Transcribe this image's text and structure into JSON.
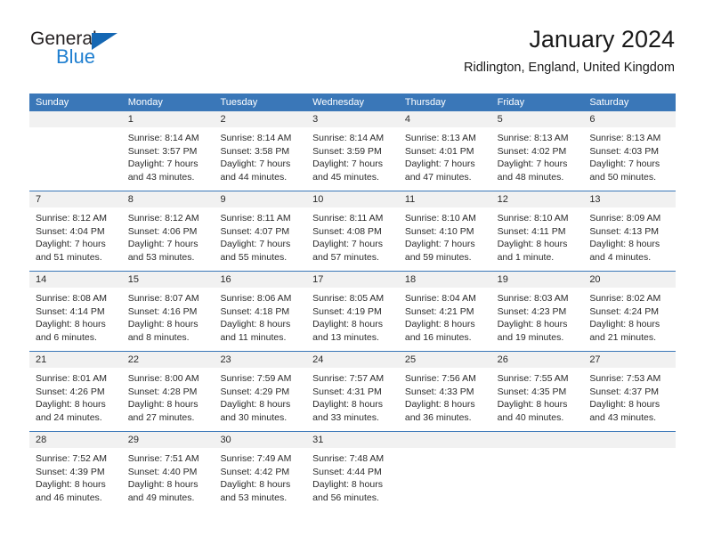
{
  "brand": {
    "name_top": "General",
    "name_bottom": "Blue",
    "triangle_icon": "triangle-icon",
    "color_primary": "#1567b3",
    "color_secondary": "#1f7fd0"
  },
  "header": {
    "title": "January 2024",
    "subtitle": "Ridlington, England, United Kingdom"
  },
  "calendar": {
    "header_bg": "#3a77b8",
    "daynum_bg": "#f1f1f1",
    "weekday_names": [
      "Sunday",
      "Monday",
      "Tuesday",
      "Wednesday",
      "Thursday",
      "Friday",
      "Saturday"
    ],
    "weeks": [
      {
        "numbers": [
          "",
          "1",
          "2",
          "3",
          "4",
          "5",
          "6"
        ],
        "days": [
          {
            "lines": [
              "",
              "",
              "",
              ""
            ]
          },
          {
            "lines": [
              "Sunrise: 8:14 AM",
              "Sunset: 3:57 PM",
              "Daylight: 7 hours",
              "and 43 minutes."
            ]
          },
          {
            "lines": [
              "Sunrise: 8:14 AM",
              "Sunset: 3:58 PM",
              "Daylight: 7 hours",
              "and 44 minutes."
            ]
          },
          {
            "lines": [
              "Sunrise: 8:14 AM",
              "Sunset: 3:59 PM",
              "Daylight: 7 hours",
              "and 45 minutes."
            ]
          },
          {
            "lines": [
              "Sunrise: 8:13 AM",
              "Sunset: 4:01 PM",
              "Daylight: 7 hours",
              "and 47 minutes."
            ]
          },
          {
            "lines": [
              "Sunrise: 8:13 AM",
              "Sunset: 4:02 PM",
              "Daylight: 7 hours",
              "and 48 minutes."
            ]
          },
          {
            "lines": [
              "Sunrise: 8:13 AM",
              "Sunset: 4:03 PM",
              "Daylight: 7 hours",
              "and 50 minutes."
            ]
          }
        ]
      },
      {
        "numbers": [
          "7",
          "8",
          "9",
          "10",
          "11",
          "12",
          "13"
        ],
        "days": [
          {
            "lines": [
              "Sunrise: 8:12 AM",
              "Sunset: 4:04 PM",
              "Daylight: 7 hours",
              "and 51 minutes."
            ]
          },
          {
            "lines": [
              "Sunrise: 8:12 AM",
              "Sunset: 4:06 PM",
              "Daylight: 7 hours",
              "and 53 minutes."
            ]
          },
          {
            "lines": [
              "Sunrise: 8:11 AM",
              "Sunset: 4:07 PM",
              "Daylight: 7 hours",
              "and 55 minutes."
            ]
          },
          {
            "lines": [
              "Sunrise: 8:11 AM",
              "Sunset: 4:08 PM",
              "Daylight: 7 hours",
              "and 57 minutes."
            ]
          },
          {
            "lines": [
              "Sunrise: 8:10 AM",
              "Sunset: 4:10 PM",
              "Daylight: 7 hours",
              "and 59 minutes."
            ]
          },
          {
            "lines": [
              "Sunrise: 8:10 AM",
              "Sunset: 4:11 PM",
              "Daylight: 8 hours",
              "and 1 minute."
            ]
          },
          {
            "lines": [
              "Sunrise: 8:09 AM",
              "Sunset: 4:13 PM",
              "Daylight: 8 hours",
              "and 4 minutes."
            ]
          }
        ]
      },
      {
        "numbers": [
          "14",
          "15",
          "16",
          "17",
          "18",
          "19",
          "20"
        ],
        "days": [
          {
            "lines": [
              "Sunrise: 8:08 AM",
              "Sunset: 4:14 PM",
              "Daylight: 8 hours",
              "and 6 minutes."
            ]
          },
          {
            "lines": [
              "Sunrise: 8:07 AM",
              "Sunset: 4:16 PM",
              "Daylight: 8 hours",
              "and 8 minutes."
            ]
          },
          {
            "lines": [
              "Sunrise: 8:06 AM",
              "Sunset: 4:18 PM",
              "Daylight: 8 hours",
              "and 11 minutes."
            ]
          },
          {
            "lines": [
              "Sunrise: 8:05 AM",
              "Sunset: 4:19 PM",
              "Daylight: 8 hours",
              "and 13 minutes."
            ]
          },
          {
            "lines": [
              "Sunrise: 8:04 AM",
              "Sunset: 4:21 PM",
              "Daylight: 8 hours",
              "and 16 minutes."
            ]
          },
          {
            "lines": [
              "Sunrise: 8:03 AM",
              "Sunset: 4:23 PM",
              "Daylight: 8 hours",
              "and 19 minutes."
            ]
          },
          {
            "lines": [
              "Sunrise: 8:02 AM",
              "Sunset: 4:24 PM",
              "Daylight: 8 hours",
              "and 21 minutes."
            ]
          }
        ]
      },
      {
        "numbers": [
          "21",
          "22",
          "23",
          "24",
          "25",
          "26",
          "27"
        ],
        "days": [
          {
            "lines": [
              "Sunrise: 8:01 AM",
              "Sunset: 4:26 PM",
              "Daylight: 8 hours",
              "and 24 minutes."
            ]
          },
          {
            "lines": [
              "Sunrise: 8:00 AM",
              "Sunset: 4:28 PM",
              "Daylight: 8 hours",
              "and 27 minutes."
            ]
          },
          {
            "lines": [
              "Sunrise: 7:59 AM",
              "Sunset: 4:29 PM",
              "Daylight: 8 hours",
              "and 30 minutes."
            ]
          },
          {
            "lines": [
              "Sunrise: 7:57 AM",
              "Sunset: 4:31 PM",
              "Daylight: 8 hours",
              "and 33 minutes."
            ]
          },
          {
            "lines": [
              "Sunrise: 7:56 AM",
              "Sunset: 4:33 PM",
              "Daylight: 8 hours",
              "and 36 minutes."
            ]
          },
          {
            "lines": [
              "Sunrise: 7:55 AM",
              "Sunset: 4:35 PM",
              "Daylight: 8 hours",
              "and 40 minutes."
            ]
          },
          {
            "lines": [
              "Sunrise: 7:53 AM",
              "Sunset: 4:37 PM",
              "Daylight: 8 hours",
              "and 43 minutes."
            ]
          }
        ]
      },
      {
        "numbers": [
          "28",
          "29",
          "30",
          "31",
          "",
          "",
          ""
        ],
        "days": [
          {
            "lines": [
              "Sunrise: 7:52 AM",
              "Sunset: 4:39 PM",
              "Daylight: 8 hours",
              "and 46 minutes."
            ]
          },
          {
            "lines": [
              "Sunrise: 7:51 AM",
              "Sunset: 4:40 PM",
              "Daylight: 8 hours",
              "and 49 minutes."
            ]
          },
          {
            "lines": [
              "Sunrise: 7:49 AM",
              "Sunset: 4:42 PM",
              "Daylight: 8 hours",
              "and 53 minutes."
            ]
          },
          {
            "lines": [
              "Sunrise: 7:48 AM",
              "Sunset: 4:44 PM",
              "Daylight: 8 hours",
              "and 56 minutes."
            ]
          },
          {
            "lines": [
              "",
              "",
              "",
              ""
            ]
          },
          {
            "lines": [
              "",
              "",
              "",
              ""
            ]
          },
          {
            "lines": [
              "",
              "",
              "",
              ""
            ]
          }
        ]
      }
    ]
  }
}
